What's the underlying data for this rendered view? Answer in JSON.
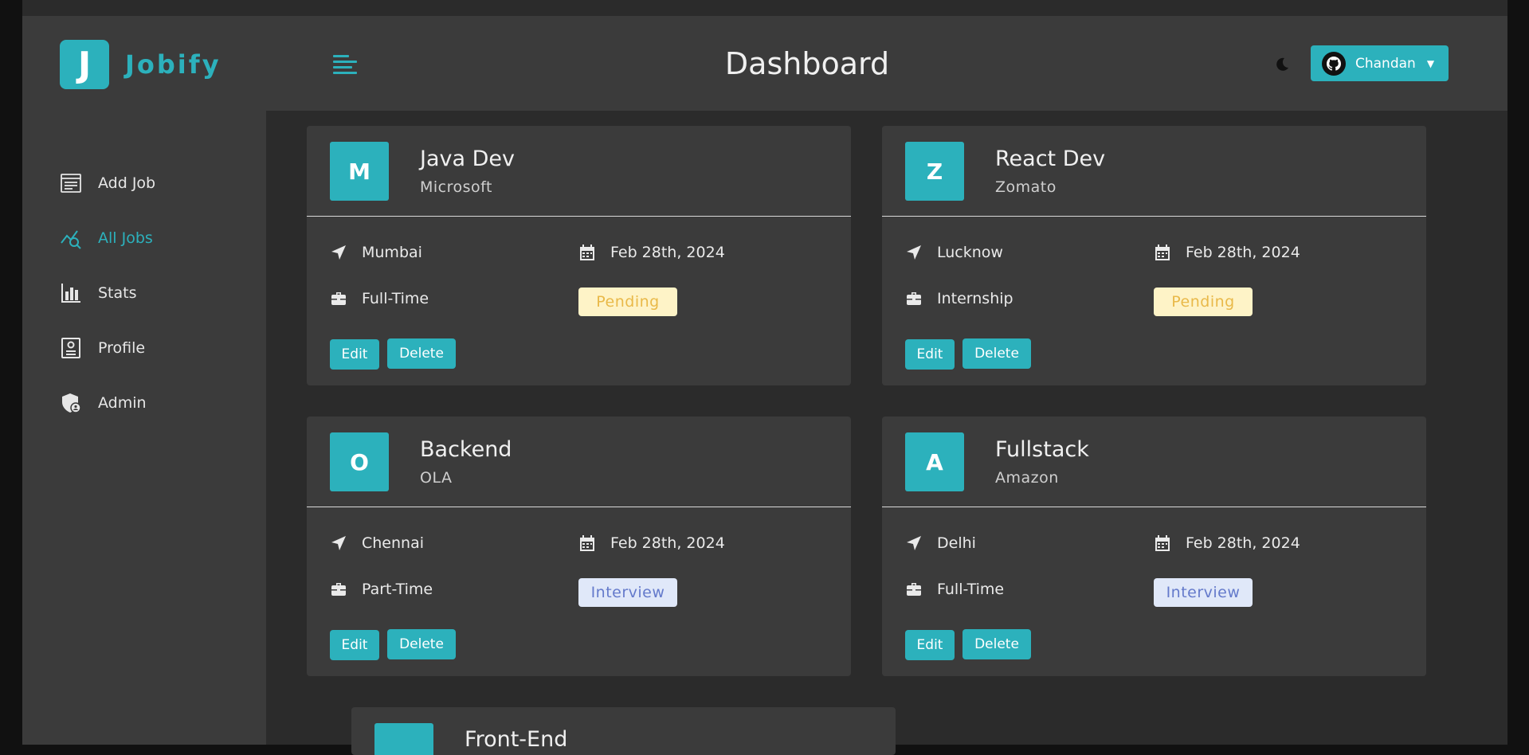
{
  "brand": {
    "logo_letter": "J",
    "name": "Jobify",
    "accent": "#2cb1bc"
  },
  "sidebar": {
    "items": [
      {
        "label": "Add Job",
        "icon": "add-job-icon",
        "active": false
      },
      {
        "label": "All Jobs",
        "icon": "all-jobs-icon",
        "active": true
      },
      {
        "label": "Stats",
        "icon": "stats-icon",
        "active": false
      },
      {
        "label": "Profile",
        "icon": "profile-icon",
        "active": false
      },
      {
        "label": "Admin",
        "icon": "admin-icon",
        "active": false
      }
    ]
  },
  "header": {
    "title": "Dashboard",
    "theme_icon": "moon-icon",
    "user": {
      "name": "Chandan",
      "avatar_icon": "github-icon"
    }
  },
  "jobs": [
    {
      "letter": "M",
      "position": "Java Dev",
      "company": "Microsoft",
      "location": "Mumbai",
      "date": "Feb 28th, 2024",
      "type": "Full-Time",
      "status": "Pending",
      "edit": "Edit",
      "delete": "Delete"
    },
    {
      "letter": "Z",
      "position": "React Dev",
      "company": "Zomato",
      "location": "Lucknow",
      "date": "Feb 28th, 2024",
      "type": "Internship",
      "status": "Pending",
      "edit": "Edit",
      "delete": "Delete"
    },
    {
      "letter": "O",
      "position": "Backend",
      "company": "OLA",
      "location": "Chennai",
      "date": "Feb 28th, 2024",
      "type": "Part-Time",
      "status": "Interview",
      "edit": "Edit",
      "delete": "Delete"
    },
    {
      "letter": "A",
      "position": "Fullstack",
      "company": "Amazon",
      "location": "Delhi",
      "date": "Feb 28th, 2024",
      "type": "Full-Time",
      "status": "Interview",
      "edit": "Edit",
      "delete": "Delete"
    },
    {
      "letter": "",
      "position": "Front-End"
    }
  ]
}
